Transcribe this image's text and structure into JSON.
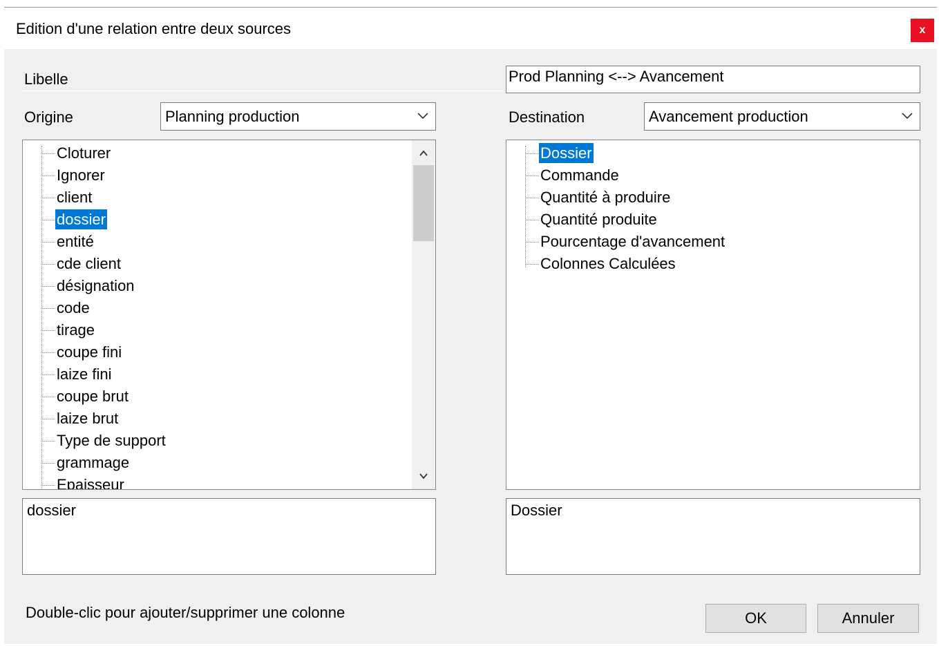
{
  "dialog": {
    "title": "Edition d'une relation entre deux sources",
    "close_label": "x"
  },
  "libelle": {
    "label": "Libelle",
    "value": "Prod Planning <--> Avancement"
  },
  "origine": {
    "label": "Origine",
    "selected": "Planning production",
    "items": [
      {
        "label": "Cloturer",
        "selected": false
      },
      {
        "label": "Ignorer",
        "selected": false
      },
      {
        "label": "client",
        "selected": false
      },
      {
        "label": "dossier",
        "selected": true
      },
      {
        "label": "entité",
        "selected": false
      },
      {
        "label": "cde client",
        "selected": false
      },
      {
        "label": "désignation",
        "selected": false
      },
      {
        "label": "code",
        "selected": false
      },
      {
        "label": "tirage",
        "selected": false
      },
      {
        "label": "coupe fini",
        "selected": false
      },
      {
        "label": "laize fini",
        "selected": false
      },
      {
        "label": "coupe brut",
        "selected": false
      },
      {
        "label": "laize brut",
        "selected": false
      },
      {
        "label": "Type de support",
        "selected": false
      },
      {
        "label": "grammage",
        "selected": false
      },
      {
        "label": "Epaisseur",
        "selected": false
      }
    ],
    "detail": "dossier"
  },
  "destination": {
    "label": "Destination",
    "selected": "Avancement production",
    "items": [
      {
        "label": "Dossier",
        "selected": true
      },
      {
        "label": "Commande",
        "selected": false
      },
      {
        "label": "Quantité à produire",
        "selected": false
      },
      {
        "label": "Quantité produite",
        "selected": false
      },
      {
        "label": "Pourcentage d'avancement",
        "selected": false
      },
      {
        "label": "Colonnes Calculées",
        "selected": false
      }
    ],
    "detail": "Dossier"
  },
  "footer": {
    "hint": "Double-clic pour ajouter/supprimer une colonne",
    "ok_label": "OK",
    "cancel_label": "Annuler"
  }
}
